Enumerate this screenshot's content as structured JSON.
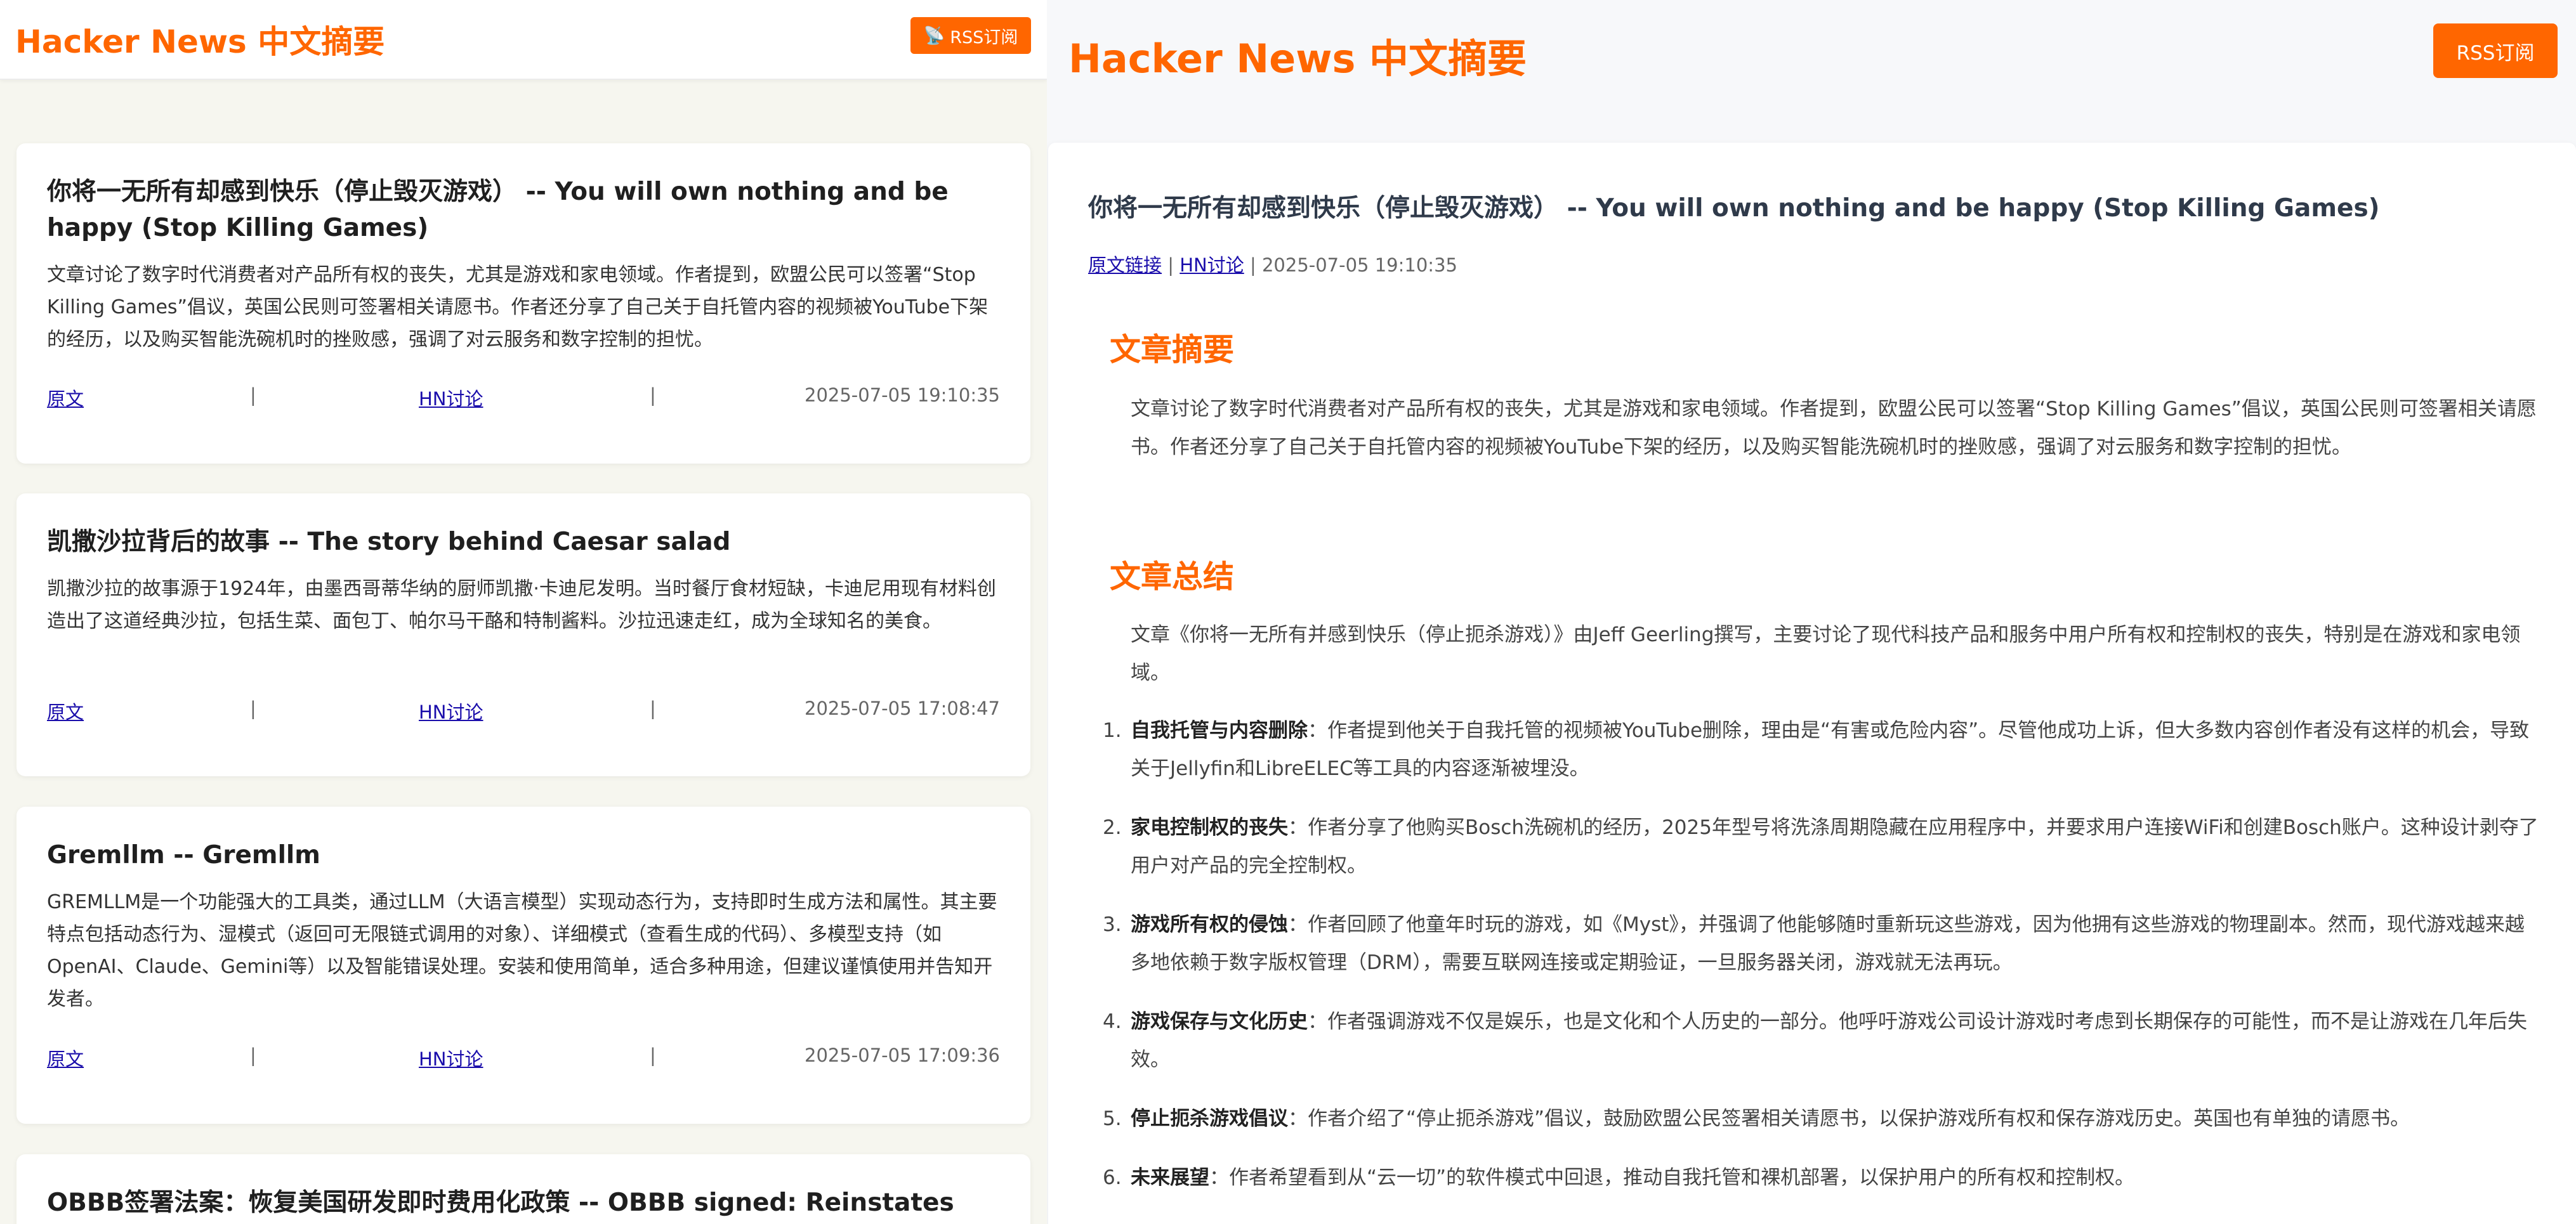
{
  "left": {
    "title": "Hacker News 中文摘要",
    "rss_label": "RSS订阅",
    "rss_icon": "📡",
    "cards": [
      {
        "title": "你将一无所有却感到快乐（停止毁灭游戏） -- You will own nothing and be happy (Stop Killing Games)",
        "summary": "文章讨论了数字时代消费者对产品所有权的丧失，尤其是游戏和家电领域。作者提到，欧盟公民可以签署“Stop Killing Games”倡议，英国公民则可签署相关请愿书。作者还分享了自己关于自托管内容的视频被YouTube下架的经历，以及购买智能洗碗机时的挫败感，强调了对云服务和数字控制的担忧。",
        "orig": "原文",
        "hn": "HN讨论",
        "sep": "|",
        "time": "2025-07-05 19:10:35"
      },
      {
        "title": "凯撒沙拉背后的故事 -- The story behind Caesar salad",
        "summary": "凯撒沙拉的故事源于1924年，由墨西哥蒂华纳的厨师凯撒·卡迪尼发明。当时餐厅食材短缺，卡迪尼用现有材料创造出了这道经典沙拉，包括生菜、面包丁、帕尔马干酪和特制酱料。沙拉迅速走红，成为全球知名的美食。",
        "orig": "原文",
        "hn": "HN讨论",
        "sep": "|",
        "time": "2025-07-05 17:08:47"
      },
      {
        "title": "Gremllm -- Gremllm",
        "summary": "GREMLLM是一个功能强大的工具类，通过LLM（大语言模型）实现动态行为，支持即时生成方法和属性。其主要特点包括动态行为、湿模式（返回可无限链式调用的对象）、详细模式（查看生成的代码）、多模型支持（如OpenAI、Claude、Gemini等）以及智能错误处理。安装和使用简单，适合多种用途，但建议谨慎使用并告知开发者。",
        "orig": "原文",
        "hn": "HN讨论",
        "sep": "|",
        "time": "2025-07-05 17:09:36"
      },
      {
        "title": "OBBB签署法案：恢复美国研发即时费用化政策 -- OBBB signed: Reinstates"
      }
    ]
  },
  "right": {
    "title": "Hacker News 中文摘要",
    "rss_label": "RSS订阅",
    "article": {
      "title": "你将一无所有却感到快乐（停止毁灭游戏） -- You will own nothing and be happy (Stop Killing Games)",
      "orig_link": "原文链接",
      "sep": "|",
      "hn_link": "HN讨论",
      "time": "2025-07-05 19:10:35",
      "summary_heading": "文章摘要",
      "summary": "文章讨论了数字时代消费者对产品所有权的丧失，尤其是游戏和家电领域。作者提到，欧盟公民可以签署“Stop Killing Games”倡议，英国公民则可签署相关请愿书。作者还分享了自己关于自托管内容的视频被YouTube下架的经历，以及购买智能洗碗机时的挫败感，强调了对云服务和数字控制的担忧。",
      "conclusion_heading": "文章总结",
      "intro": "文章《你将一无所有并感到快乐（停止扼杀游戏）》由Jeff Geerling撰写，主要讨论了现代科技产品和服务中用户所有权和控制权的丧失，特别是在游戏和家电领域。",
      "points": [
        {
          "num": "1.",
          "title": "自我托管与内容删除",
          "text": "：作者提到他关于自我托管的视频被YouTube删除，理由是“有害或危险内容”。尽管他成功上诉，但大多数内容创作者没有这样的机会，导致关于Jellyfin和LibreELEC等工具的内容逐渐被埋没。"
        },
        {
          "num": "2.",
          "title": "家电控制权的丧失",
          "text": "：作者分享了他购买Bosch洗碗机的经历，2025年型号将洗涤周期隐藏在应用程序中，并要求用户连接WiFi和创建Bosch账户。这种设计剥夺了用户对产品的完全控制权。"
        },
        {
          "num": "3.",
          "title": "游戏所有权的侵蚀",
          "text": "：作者回顾了他童年时玩的游戏，如《Myst》，并强调了他能够随时重新玩这些游戏，因为他拥有这些游戏的物理副本。然而，现代游戏越来越多地依赖于数字版权管理（DRM），需要互联网连接或定期验证，一旦服务器关闭，游戏就无法再玩。"
        },
        {
          "num": "4.",
          "title": "游戏保存与文化历史",
          "text": "：作者强调游戏不仅是娱乐，也是文化和个人历史的一部分。他呼吁游戏公司设计游戏时考虑到长期保存的可能性，而不是让游戏在几年后失效。"
        },
        {
          "num": "5.",
          "title": "停止扼杀游戏倡议",
          "text": "：作者介绍了“停止扼杀游戏”倡议，鼓励欧盟公民签署相关请愿书，以保护游戏所有权和保存游戏历史。英国也有单独的请愿书。"
        },
        {
          "num": "6.",
          "title": "未来展望",
          "text": "：作者希望看到从“云一切”的软件模式中回退，推动自我托管和裸机部署，以保护用户的所有权和控制权。"
        }
      ]
    }
  },
  "colors": {
    "accent": "#ff6600",
    "link": "#1a0dab"
  }
}
